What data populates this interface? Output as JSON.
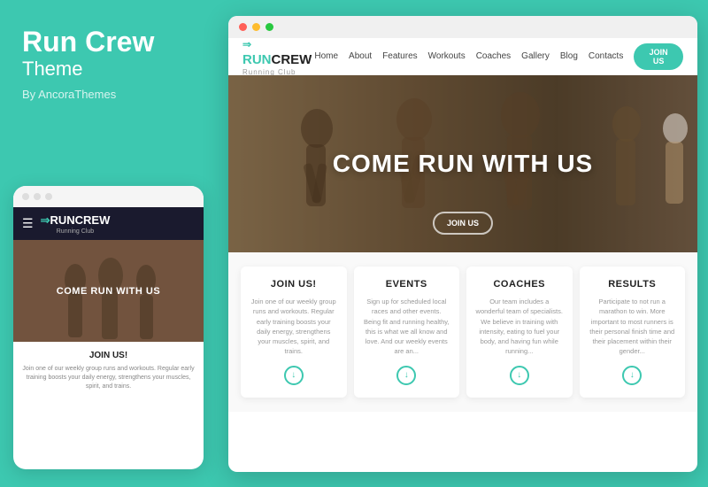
{
  "leftPanel": {
    "title": "Run Crew",
    "subtitle": "Theme",
    "byLine": "By AncoraThemes"
  },
  "mobilePreview": {
    "logoMain": "RUN",
    "logoBrand": "CREW",
    "logoSub": "Running Club",
    "heroText": "COME RUN WITH US",
    "sectionTitle": "JOIN US!",
    "sectionText": "Join one of our weekly group runs and workouts. Regular early training boosts your daily energy, strengthens your muscles, spirit, and trains."
  },
  "browserPreview": {
    "nav": {
      "logoMain": "RUN",
      "logoBrand": "CREW",
      "logoSub": "Running Club",
      "links": [
        "Home",
        "About",
        "Features",
        "Workouts",
        "Coaches",
        "Gallery",
        "Blog",
        "Contacts"
      ],
      "joinBtn": "JOIN US"
    },
    "hero": {
      "text": "COME RUN WITH US",
      "joinBtn": "JOIN US"
    },
    "cards": [
      {
        "title": "JOIN US!",
        "text": "Join one of our weekly group runs and workouts. Regular early training boosts your daily energy, strengthens your muscles, spirit, and trains."
      },
      {
        "title": "EVENTS",
        "text": "Sign up for scheduled local races and other events. Being fit and running healthy, this is what we all know and love. And our weekly events are an..."
      },
      {
        "title": "COACHES",
        "text": "Our team includes a wonderful team of specialists. We believe in training with intensity, eating to fuel your body, and having fun while running..."
      },
      {
        "title": "RESULTS",
        "text": "Participate to not run a marathon to win. More important to most runners is their personal finish time and their placement within their gender..."
      }
    ]
  },
  "colors": {
    "teal": "#3dc8b0",
    "dark": "#1a1a2e",
    "white": "#ffffff"
  }
}
